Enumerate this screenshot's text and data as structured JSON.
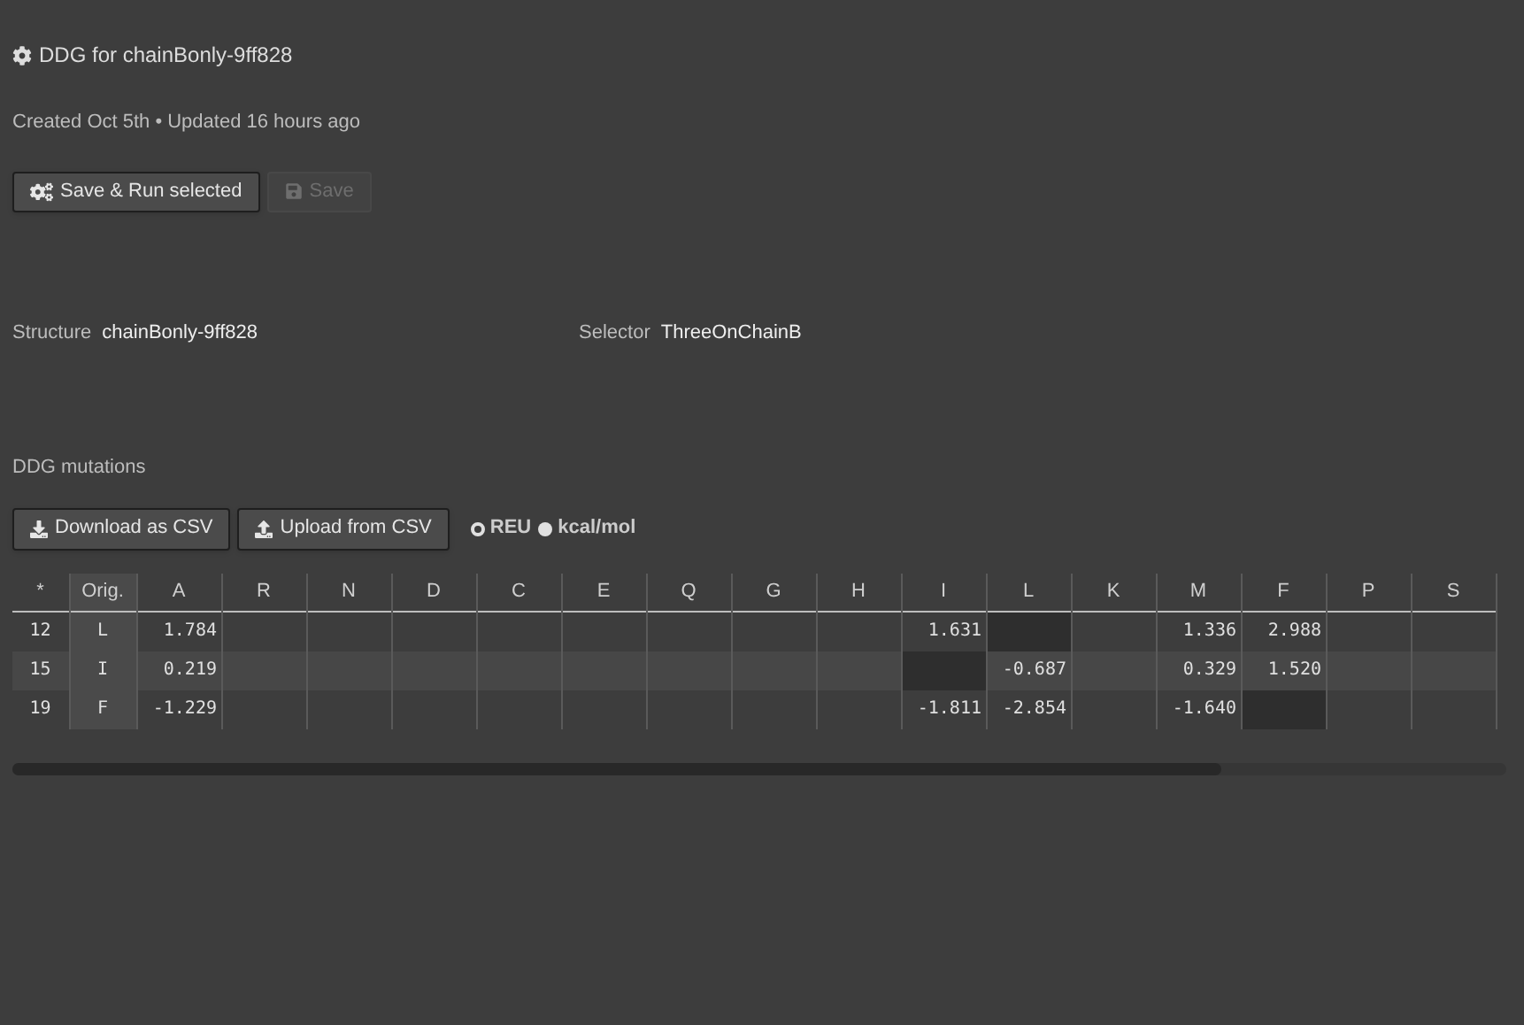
{
  "title": "DDG for chainBonly-9ff828",
  "meta": "Created Oct 5th • Updated 16 hours ago",
  "actions": [
    {
      "label": "Save & Run selected",
      "disabled": false
    },
    {
      "label": "Save",
      "disabled": true
    }
  ],
  "fields": [
    {
      "label": "Structure",
      "value": "chainBonly-9ff828"
    },
    {
      "label": "Selector",
      "value": "ThreeOnChainB"
    }
  ],
  "section_title": "DDG mutations",
  "csv_buttons": [
    {
      "kind": "download",
      "label": "Download as CSV"
    },
    {
      "kind": "upload",
      "label": "Upload from CSV"
    }
  ],
  "units": [
    {
      "label": "REU",
      "selected": true
    },
    {
      "label": "kcal/mol",
      "selected": false
    }
  ],
  "table": {
    "columns": [
      "*",
      "Orig.",
      "A",
      "R",
      "N",
      "D",
      "C",
      "E",
      "Q",
      "G",
      "H",
      "I",
      "L",
      "K",
      "M",
      "F",
      "P",
      "S"
    ],
    "rows": [
      {
        "cells": [
          {
            "kind": "position",
            "text": "12"
          },
          {
            "kind": "orig",
            "text": "L"
          },
          {
            "kind": "value",
            "text": "1.784"
          },
          {
            "kind": "empty"
          },
          {
            "kind": "empty"
          },
          {
            "kind": "empty"
          },
          {
            "kind": "empty"
          },
          {
            "kind": "empty"
          },
          {
            "kind": "empty"
          },
          {
            "kind": "empty"
          },
          {
            "kind": "empty"
          },
          {
            "kind": "value",
            "text": "1.631"
          },
          {
            "kind": "native"
          },
          {
            "kind": "empty"
          },
          {
            "kind": "value",
            "text": "1.336"
          },
          {
            "kind": "value",
            "text": "2.988"
          },
          {
            "kind": "empty"
          },
          {
            "kind": "empty"
          }
        ]
      },
      {
        "cells": [
          {
            "kind": "position",
            "text": "15"
          },
          {
            "kind": "orig",
            "text": "I"
          },
          {
            "kind": "value",
            "text": "0.219"
          },
          {
            "kind": "empty"
          },
          {
            "kind": "empty"
          },
          {
            "kind": "empty"
          },
          {
            "kind": "empty"
          },
          {
            "kind": "empty"
          },
          {
            "kind": "empty"
          },
          {
            "kind": "empty"
          },
          {
            "kind": "empty"
          },
          {
            "kind": "native"
          },
          {
            "kind": "value",
            "text": "-0.687"
          },
          {
            "kind": "empty"
          },
          {
            "kind": "value",
            "text": "0.329"
          },
          {
            "kind": "value",
            "text": "1.520"
          },
          {
            "kind": "empty"
          },
          {
            "kind": "empty"
          }
        ]
      },
      {
        "cells": [
          {
            "kind": "position",
            "text": "19"
          },
          {
            "kind": "orig",
            "text": "F"
          },
          {
            "kind": "value",
            "text": "-1.229"
          },
          {
            "kind": "empty"
          },
          {
            "kind": "empty"
          },
          {
            "kind": "empty"
          },
          {
            "kind": "empty"
          },
          {
            "kind": "empty"
          },
          {
            "kind": "empty"
          },
          {
            "kind": "empty"
          },
          {
            "kind": "empty"
          },
          {
            "kind": "value",
            "text": "-1.811"
          },
          {
            "kind": "value",
            "text": "-2.854"
          },
          {
            "kind": "empty"
          },
          {
            "kind": "value",
            "text": "-1.640"
          },
          {
            "kind": "native"
          },
          {
            "kind": "empty"
          },
          {
            "kind": "empty"
          }
        ]
      }
    ]
  }
}
